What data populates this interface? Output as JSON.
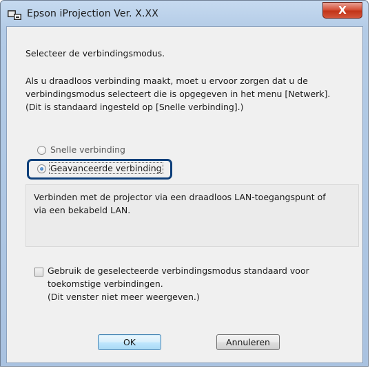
{
  "window": {
    "title": "Epson iProjection Ver. X.XX",
    "close_glyph": "X"
  },
  "instruction": "Selecteer de verbindingsmodus.",
  "info_lines": [
    "Als u draadloos verbinding maakt, moet u ervoor zorgen dat u de",
    "verbindingsmodus selecteert die is opgegeven in het menu [Netwerk].",
    "(Dit is standaard ingesteld op [Snelle verbinding].)"
  ],
  "modes": [
    {
      "label": "Snelle verbinding",
      "selected": false
    },
    {
      "label": "Geavanceerde verbinding",
      "selected": true
    }
  ],
  "description_lines": [
    "Verbinden met de projector via een draadloos LAN-toegangspunt of",
    "via een bekabeld LAN."
  ],
  "default_option": {
    "checked": false,
    "lines": [
      "Gebruik de geselecteerde verbindingsmodus standaard voor",
      "toekomstige verbindingen.",
      "(Dit venster niet meer weergeven.)"
    ]
  },
  "buttons": {
    "ok": "OK",
    "cancel": "Annuleren"
  },
  "colors": {
    "highlight": "#0d3f7a",
    "close_button": "#c23519",
    "title_bar": "#b3cbe6"
  },
  "icons": {
    "app": "epson-app-icon",
    "close": "close-icon"
  }
}
